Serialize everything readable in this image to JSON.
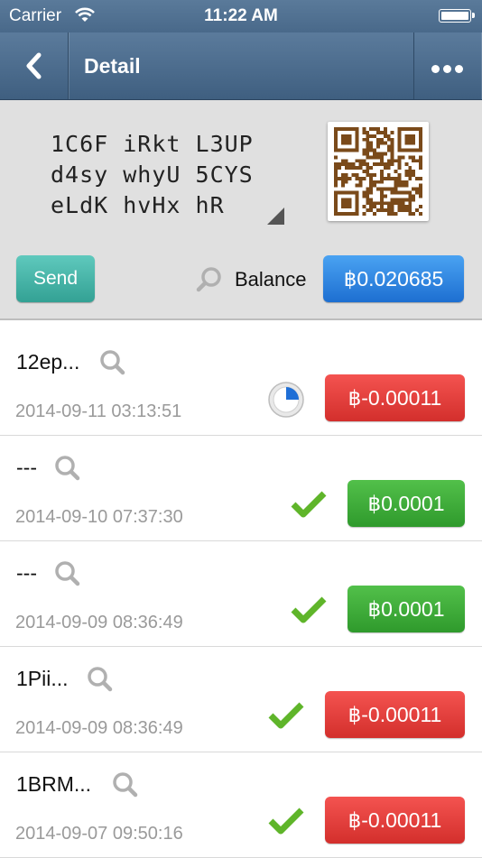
{
  "status_bar": {
    "carrier": "Carrier",
    "time": "11:22 AM"
  },
  "nav": {
    "title": "Detail",
    "back_icon": "chevron-left-icon",
    "more_icon": "more-dots-icon"
  },
  "address": {
    "lines": [
      "1C6F iRkt L3UP",
      "d4sy whyU 5CYS",
      "eLdK hvHx hR"
    ]
  },
  "actions": {
    "send_label": "Send",
    "balance_label": "Balance",
    "balance_value": "฿0.020685"
  },
  "transactions": [
    {
      "title": "12ep...",
      "date": "2014-09-11 03:13:51",
      "amount": "฿-0.00011",
      "kind": "neg",
      "status": "pending",
      "progress": 0.25
    },
    {
      "title": "---",
      "date": "2014-09-10 07:37:30",
      "amount": "฿0.0001",
      "kind": "pos",
      "status": "confirmed"
    },
    {
      "title": "---",
      "date": "2014-09-09 08:36:49",
      "amount": "฿0.0001",
      "kind": "pos",
      "status": "confirmed"
    },
    {
      "title": "1Pii...",
      "date": "2014-09-09 08:36:49",
      "amount": "฿-0.00011",
      "kind": "neg",
      "status": "confirmed"
    },
    {
      "title": "1BRM...",
      "date": "2014-09-07 09:50:16",
      "amount": "฿-0.00011",
      "kind": "neg",
      "status": "confirmed"
    }
  ],
  "colors": {
    "navbar": "#4a6a8b",
    "send": "#3aa89b",
    "balance": "#2a80e0",
    "negative": "#e23c39",
    "positive": "#3eab38",
    "check": "#5fb52a"
  }
}
